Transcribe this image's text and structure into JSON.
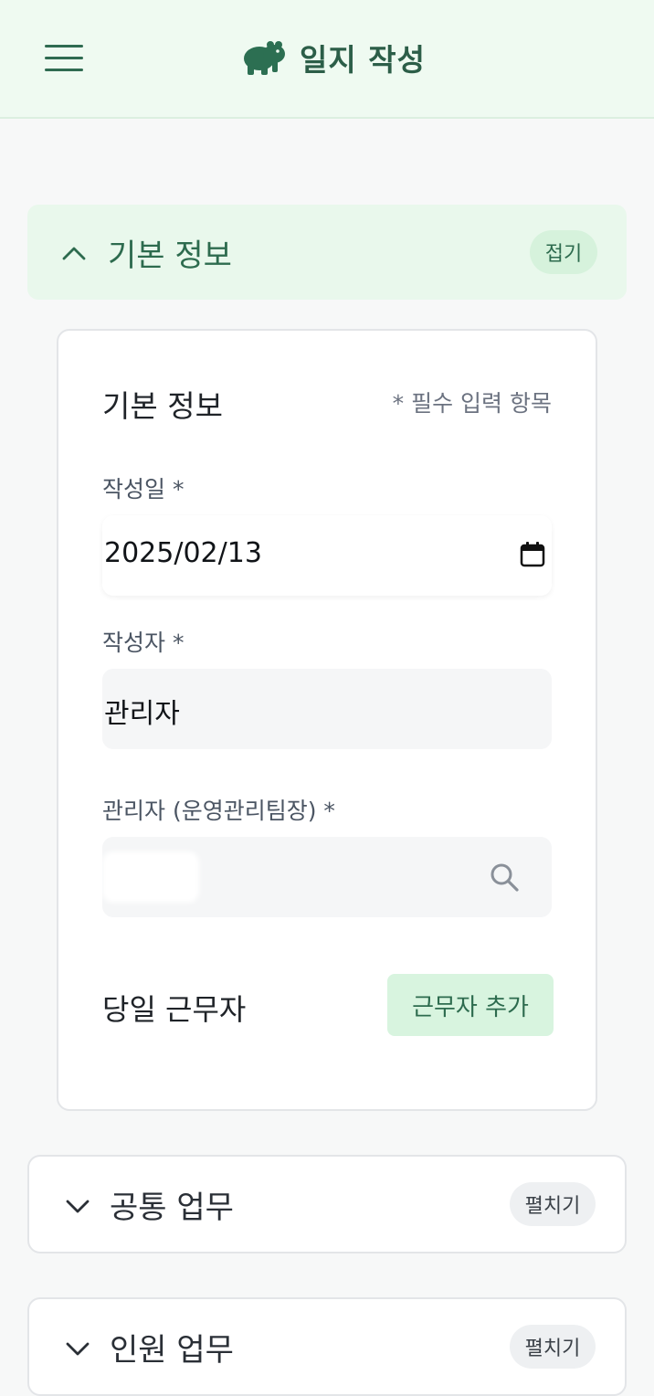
{
  "header": {
    "title": "일지 작성",
    "logo_icon": "hippo-icon",
    "menu_icon": "hamburger-menu-icon",
    "brand_color": "#2c5e48"
  },
  "sections": [
    {
      "title": "기본 정보",
      "toggle_label": "접기",
      "state": "expanded",
      "chevron_icon": "chevron-up-icon"
    },
    {
      "title": "공통 업무",
      "toggle_label": "펼치기",
      "state": "collapsed",
      "chevron_icon": "chevron-down-icon"
    },
    {
      "title": "인원 업무",
      "toggle_label": "펼치기",
      "state": "collapsed",
      "chevron_icon": "chevron-down-icon"
    }
  ],
  "basic_info_card": {
    "title": "기본 정보",
    "required_note": "* 필수 입력 항목",
    "date_label": "작성일 *",
    "date_value": "2025/02/13",
    "author_label": "작성자 *",
    "author_value": "관리자",
    "manager_label": "관리자 (운영관리팀장) *",
    "manager_value": "",
    "workers_title": "당일 근무자",
    "add_worker_label": "근무자 추가"
  }
}
